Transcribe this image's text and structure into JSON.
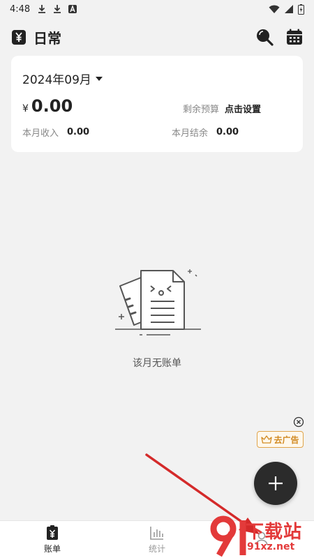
{
  "status_bar": {
    "time": "4:48"
  },
  "app_bar": {
    "title": "日常"
  },
  "summary": {
    "month": "2024年09月",
    "currency": "¥",
    "expense": "0.00",
    "budget_label": "剩余预算",
    "budget_value": "点击设置",
    "income_label": "本月收入",
    "income_value": "0.00",
    "balance_label": "本月结余",
    "balance_value": "0.00"
  },
  "empty_state": {
    "message": "该月无账单"
  },
  "ad": {
    "label": "去广告"
  },
  "bottom_nav": {
    "items": [
      {
        "label": "账单"
      },
      {
        "label": "统计"
      },
      {
        "label": ""
      }
    ]
  },
  "watermark": {
    "text_cn": "下载站",
    "url": "91xz.net"
  },
  "colors": {
    "accent": "#2b2b2b",
    "ad": "#d28a22",
    "annotation_arrow": "#d42a2a",
    "watermark": "#e33a3a"
  }
}
